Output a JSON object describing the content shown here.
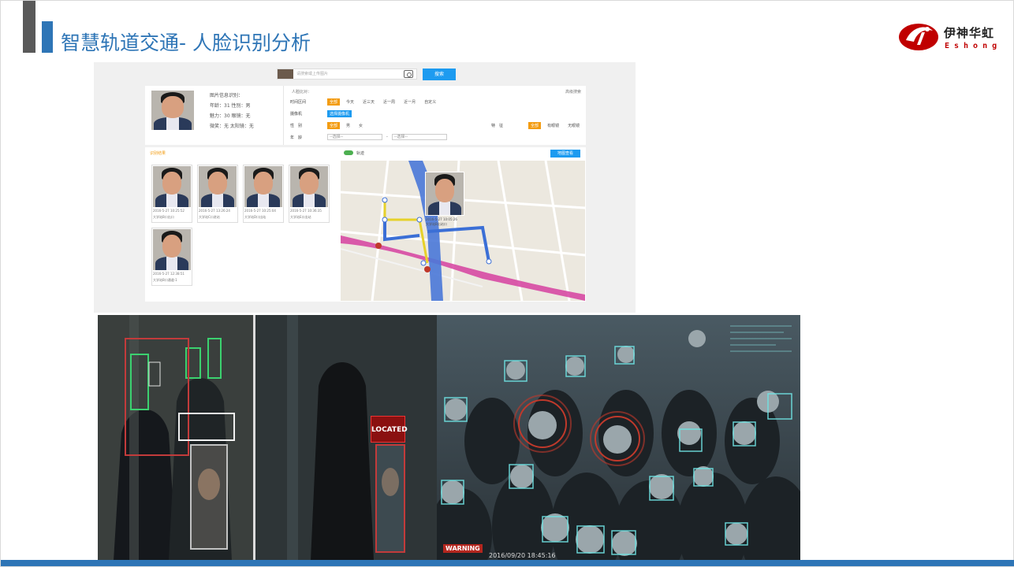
{
  "slide": {
    "title": "智慧轨道交通- 人脸识别分析",
    "logo_cn": "伊神华虹",
    "logo_en": "Eshong",
    "brand_color": "#2e75b6"
  },
  "search": {
    "placeholder": "请搜索或上传图片",
    "button": "搜索"
  },
  "profile": {
    "heading": "图片信息识别：",
    "lines": [
      "年龄：31  性别：男",
      "魅力：30  眼镜：无",
      "微笑：无  太阳镜：无"
    ]
  },
  "filters": {
    "title": "人脸比对：",
    "more": "高级搜索",
    "time_label": "时间区间",
    "time_options": [
      "全部",
      "今天",
      "近三天",
      "近一周",
      "近一月",
      "自定义"
    ],
    "camera_label": "摄像机",
    "camera_button": "选择摄像机",
    "gender_label": "性　别",
    "gender_options": [
      "全部",
      "男",
      "女"
    ],
    "feature_label": "特　征",
    "feature_options": [
      "全部",
      "有眼镜",
      "无眼镜"
    ],
    "age_label": "年　龄",
    "age_select1": "--选择--",
    "age_select2": "--选择--"
  },
  "results": {
    "label": "识别结果",
    "items": [
      {
        "time": "2016-5-27 10:25:52",
        "place": "大学站B口出口"
      },
      {
        "time": "2016-5-27 13:26:24",
        "place": "大学站C口进站"
      },
      {
        "time": "2016-5-27 10:25:04",
        "place": "大学站D口出站"
      },
      {
        "time": "2016-5-27 10:36:35",
        "place": "大学站E口出站"
      },
      {
        "time": "2016-5-27 12:38:51",
        "place": "大学站B口通道-1"
      }
    ]
  },
  "map": {
    "toggle_label": "轨迹",
    "button": "地图查看",
    "popup_time": "2016-5-27 10:05:26",
    "popup_place": "大学站B出站口"
  },
  "photos": {
    "located": "LOCATED",
    "warning": "WARNING",
    "timestamp": "2016/09/20 18:45:16"
  }
}
